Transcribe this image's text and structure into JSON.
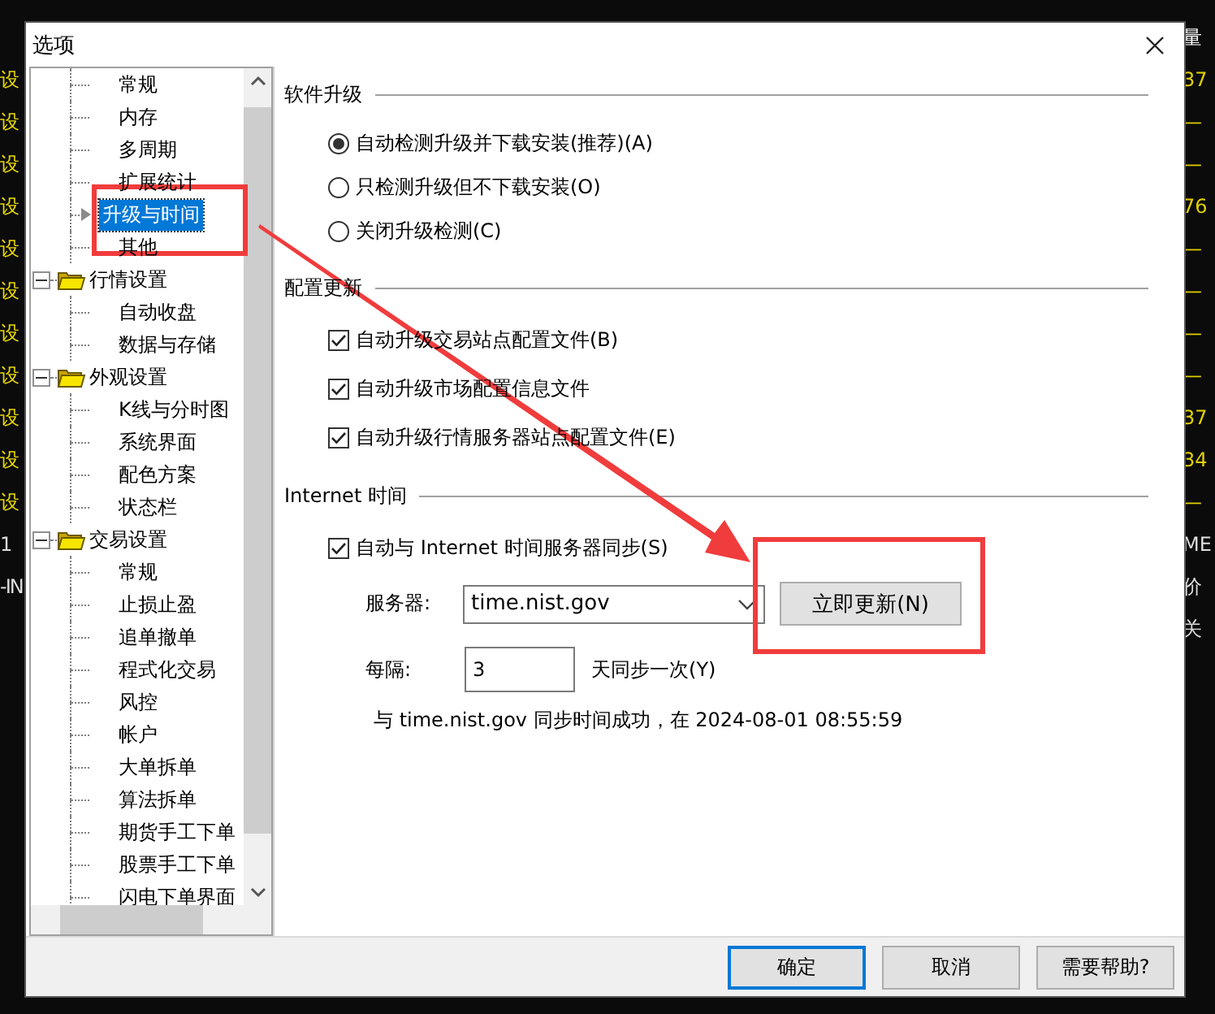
{
  "background": {
    "left_fragments": [
      "设",
      "设",
      "设",
      "设",
      "设",
      "设",
      "设",
      "设",
      "设",
      "设",
      "设",
      "1",
      "-IN"
    ],
    "right_fragments": [
      "量",
      "37",
      "—",
      "—",
      "76",
      "—",
      "—",
      "—",
      "—",
      "37",
      "34",
      "—",
      "ME",
      "价",
      "关"
    ]
  },
  "window": {
    "title": "选项"
  },
  "tree": [
    {
      "children": [
        {
          "label": "常规",
          "selected": false
        },
        {
          "label": "内存",
          "selected": false
        },
        {
          "label": "多周期",
          "selected": false
        },
        {
          "label": "扩展统计",
          "selected": false
        },
        {
          "label": "升级与时间",
          "selected": true
        },
        {
          "label": "其他",
          "selected": false
        }
      ]
    },
    {
      "label": "行情设置",
      "expanded": true,
      "children": [
        {
          "label": "自动收盘",
          "selected": false
        },
        {
          "label": "数据与存储",
          "selected": false
        }
      ]
    },
    {
      "label": "外观设置",
      "expanded": true,
      "children": [
        {
          "label": "K线与分时图",
          "selected": false
        },
        {
          "label": "系统界面",
          "selected": false
        },
        {
          "label": "配色方案",
          "selected": false
        },
        {
          "label": "状态栏",
          "selected": false
        }
      ]
    },
    {
      "label": "交易设置",
      "expanded": true,
      "children": [
        {
          "label": "常规",
          "selected": false
        },
        {
          "label": "止损止盈",
          "selected": false
        },
        {
          "label": "追单撤单",
          "selected": false
        },
        {
          "label": "程式化交易",
          "selected": false
        },
        {
          "label": "风控",
          "selected": false
        },
        {
          "label": "帐户",
          "selected": false
        },
        {
          "label": "大单拆单",
          "selected": false
        },
        {
          "label": "算法拆单",
          "selected": false
        },
        {
          "label": "期货手工下单",
          "selected": false
        },
        {
          "label": "股票手工下单",
          "selected": false
        },
        {
          "label": "闪电下单界面",
          "selected": false
        }
      ]
    }
  ],
  "sections": [
    {
      "title": "软件升级",
      "options": [
        {
          "kind": "radio",
          "label": "自动检测升级并下载安装(推荐)(A)",
          "selected": true
        },
        {
          "kind": "radio",
          "label": "只检测升级但不下载安装(O)",
          "selected": false
        },
        {
          "kind": "radio",
          "label": "关闭升级检测(C)",
          "selected": false
        }
      ]
    },
    {
      "title": "配置更新",
      "options": [
        {
          "kind": "checkbox",
          "label": "自动升级交易站点配置文件(B)",
          "checked": true
        },
        {
          "kind": "checkbox",
          "label": "自动升级市场配置信息文件",
          "checked": true
        },
        {
          "kind": "checkbox",
          "label": "自动升级行情服务器站点配置文件(E)",
          "checked": true
        }
      ]
    },
    {
      "title": "Internet 时间",
      "options": [
        {
          "kind": "checkbox",
          "label": "自动与 Internet 时间服务器同步(S)",
          "checked": true
        }
      ]
    }
  ],
  "time_sync": {
    "server_label": "服务器:",
    "server": "time.nist.gov",
    "update_button": "立即更新(N)",
    "interval_label": "每隔:",
    "interval": "3",
    "interval_suffix": "天同步一次(Y)",
    "status": "与 time.nist.gov 同步时间成功，在 2024-08-01 08:55:59"
  },
  "buttons": [
    {
      "label": "确定",
      "default": true
    },
    {
      "label": "取消",
      "default": false
    },
    {
      "label": "需要帮助?",
      "default": false
    }
  ]
}
